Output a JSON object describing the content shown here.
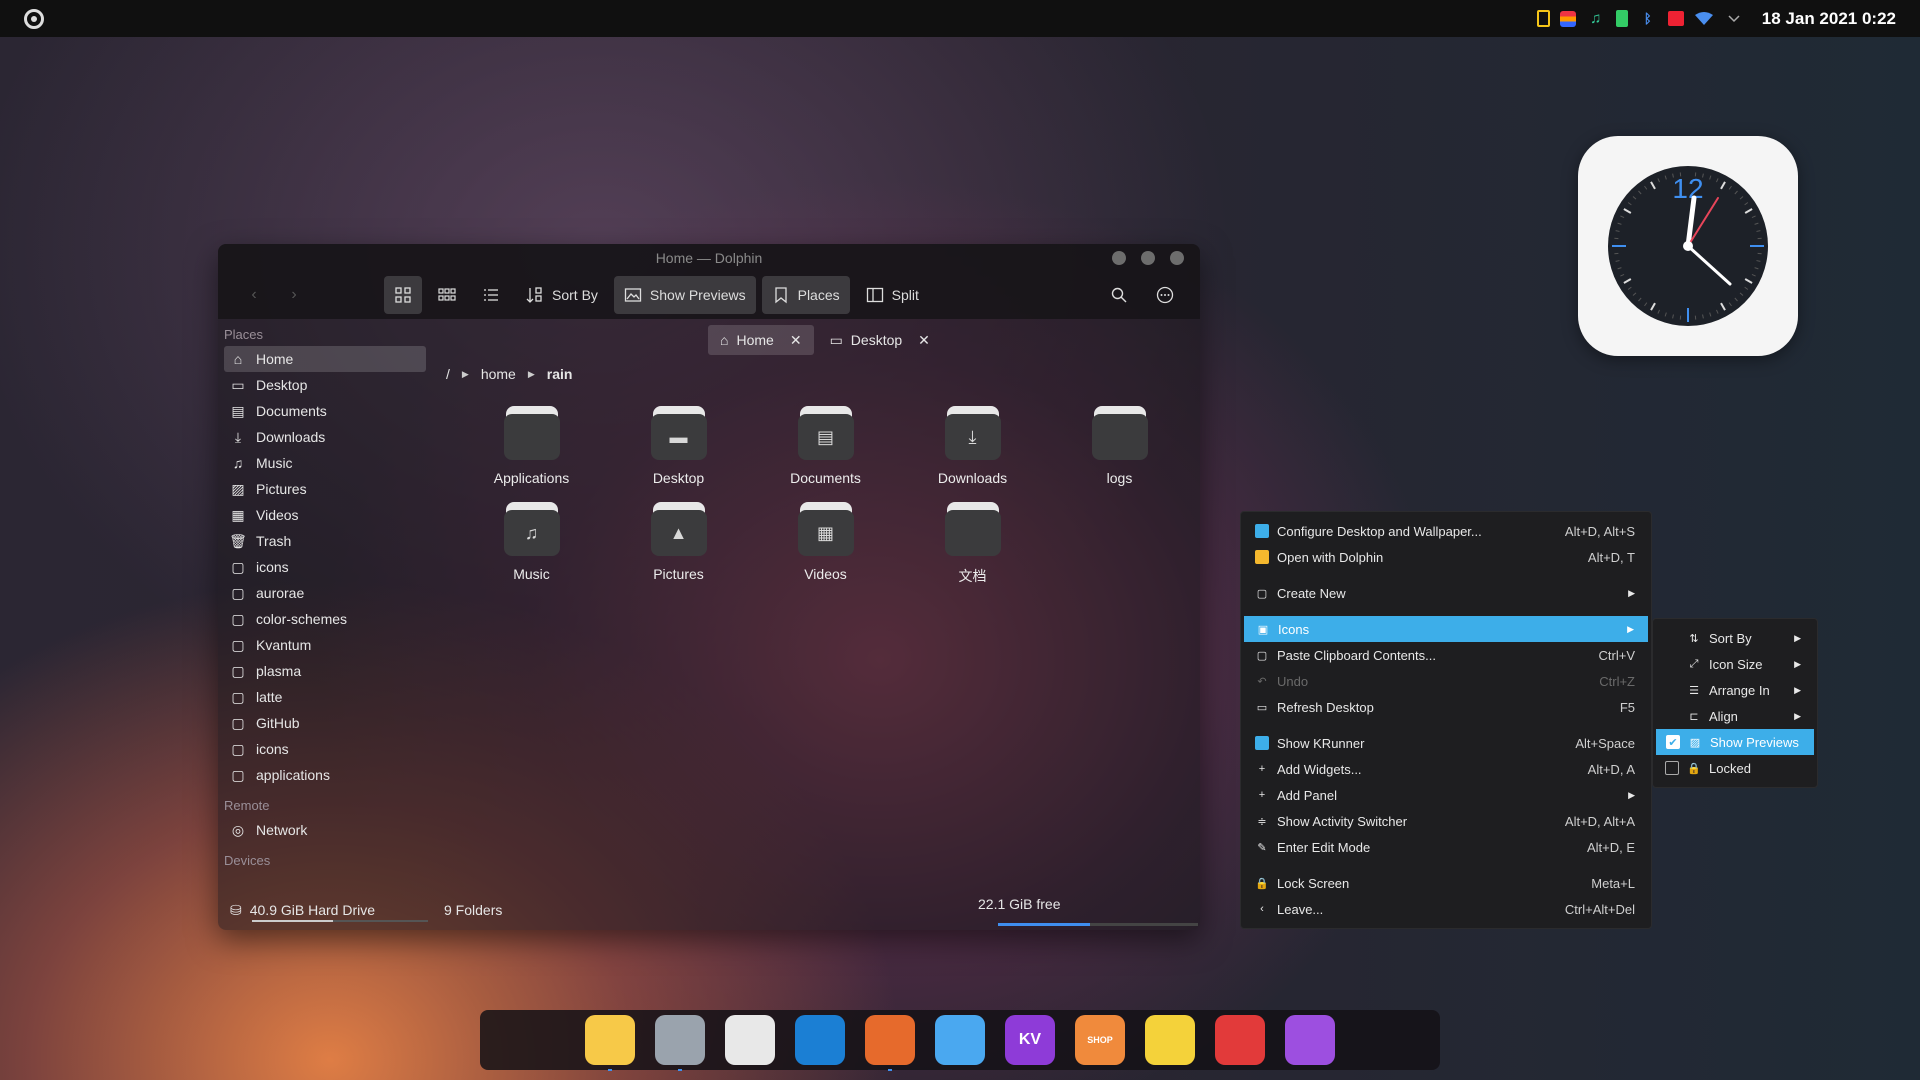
{
  "panel": {
    "datetime": "18 Jan 2021 0:22",
    "tray_icons": [
      "clipboard-icon",
      "color-icon",
      "audio-icon",
      "battery-icon",
      "bluetooth-icon",
      "calendar-icon",
      "wifi-icon",
      "chevron-down-icon"
    ]
  },
  "window": {
    "title": "Home — Dolphin",
    "toolbar": {
      "sort_by": "Sort By",
      "show_previews": "Show Previews",
      "places": "Places",
      "split": "Split"
    },
    "sidebar": {
      "places_title": "Places",
      "places": [
        {
          "label": "Home",
          "icon": "home-icon"
        },
        {
          "label": "Desktop",
          "icon": "desktop-icon"
        },
        {
          "label": "Documents",
          "icon": "documents-icon"
        },
        {
          "label": "Downloads",
          "icon": "downloads-icon"
        },
        {
          "label": "Music",
          "icon": "music-icon"
        },
        {
          "label": "Pictures",
          "icon": "pictures-icon"
        },
        {
          "label": "Videos",
          "icon": "videos-icon"
        },
        {
          "label": "Trash",
          "icon": "trash-icon"
        },
        {
          "label": "icons",
          "icon": "folder-icon"
        },
        {
          "label": "aurorae",
          "icon": "folder-icon"
        },
        {
          "label": "color-schemes",
          "icon": "folder-icon"
        },
        {
          "label": "Kvantum",
          "icon": "folder-icon"
        },
        {
          "label": "plasma",
          "icon": "folder-icon"
        },
        {
          "label": "latte",
          "icon": "folder-icon"
        },
        {
          "label": "GitHub",
          "icon": "folder-icon"
        },
        {
          "label": "icons",
          "icon": "folder-icon"
        },
        {
          "label": "applications",
          "icon": "folder-icon"
        }
      ],
      "remote_title": "Remote",
      "remote": [
        {
          "label": "Network",
          "icon": "network-icon"
        }
      ],
      "devices_title": "Devices",
      "devices": [
        {
          "label": "40.9 GiB Hard Drive",
          "icon": "drive-icon"
        }
      ]
    },
    "tabs": [
      {
        "label": "Home",
        "icon": "home-icon"
      },
      {
        "label": "Desktop",
        "icon": "desktop-icon"
      }
    ],
    "breadcrumb": [
      "/",
      "home",
      "rain"
    ],
    "files": [
      {
        "name": "Applications",
        "icon": "folder-icon"
      },
      {
        "name": "Desktop",
        "icon": "desktop-folder-icon"
      },
      {
        "name": "Documents",
        "icon": "documents-folder-icon"
      },
      {
        "name": "Downloads",
        "icon": "downloads-folder-icon"
      },
      {
        "name": "logs",
        "icon": "folder-icon"
      },
      {
        "name": "Music",
        "icon": "music-folder-icon"
      },
      {
        "name": "Pictures",
        "icon": "pictures-folder-icon"
      },
      {
        "name": "Videos",
        "icon": "videos-folder-icon"
      },
      {
        "name": "文档",
        "icon": "folder-icon"
      }
    ],
    "status": {
      "folders": "9 Folders",
      "free": "22.1 GiB free",
      "free_fraction": 0.46,
      "drive_used_fraction": 0.46
    }
  },
  "context_menu": {
    "items": [
      {
        "label": "Configure Desktop and Wallpaper...",
        "shortcut": "Alt+D, Alt+S"
      },
      {
        "label": "Open with Dolphin",
        "shortcut": "Alt+D, T"
      },
      {
        "label": "Create New",
        "shortcut": ""
      },
      {
        "label": "Icons",
        "shortcut": ""
      },
      {
        "label": "Paste Clipboard Contents...",
        "shortcut": "Ctrl+V"
      },
      {
        "label": "Undo",
        "shortcut": "Ctrl+Z"
      },
      {
        "label": "Refresh Desktop",
        "shortcut": "F5"
      },
      {
        "label": "Show KRunner",
        "shortcut": "Alt+Space"
      },
      {
        "label": "Add Widgets...",
        "shortcut": "Alt+D, A"
      },
      {
        "label": "Add Panel",
        "shortcut": ""
      },
      {
        "label": "Show Activity Switcher",
        "shortcut": "Alt+D, Alt+A"
      },
      {
        "label": "Enter Edit Mode",
        "shortcut": "Alt+D, E"
      },
      {
        "label": "Lock Screen",
        "shortcut": "Meta+L"
      },
      {
        "label": "Leave...",
        "shortcut": "Ctrl+Alt+Del"
      }
    ]
  },
  "submenu": {
    "items": [
      {
        "label": "Sort By"
      },
      {
        "label": "Icon Size"
      },
      {
        "label": "Arrange In"
      },
      {
        "label": "Align"
      },
      {
        "label": "Show Previews",
        "checked": true
      },
      {
        "label": "Locked",
        "checked": false
      }
    ]
  },
  "dock": {
    "apps": [
      {
        "icon": "files-icon",
        "color": "#f7c948",
        "running": true
      },
      {
        "icon": "settings-icon",
        "color": "#9aa3ad",
        "running": true
      },
      {
        "icon": "inkscape-icon",
        "color": "#e8e8e8",
        "running": false
      },
      {
        "icon": "edge-dev-icon",
        "color": "#1b7fd4",
        "running": false
      },
      {
        "icon": "firefox-icon",
        "color": "#e66a2c",
        "running": true
      },
      {
        "icon": "github-icon",
        "color": "#4aa8f0",
        "running": false
      },
      {
        "icon": "kvantum-icon",
        "color": "#8e3bd8",
        "label": "KV",
        "running": false
      },
      {
        "icon": "shop-icon",
        "color": "#f08a3c",
        "label": "SHOP",
        "running": false
      },
      {
        "icon": "music-app-icon",
        "color": "#f4d23a",
        "running": false
      },
      {
        "icon": "netease-music-icon",
        "color": "#e23a3a",
        "running": false
      },
      {
        "icon": "screenshot-icon",
        "color": "#9d4fe0",
        "running": false
      }
    ]
  }
}
